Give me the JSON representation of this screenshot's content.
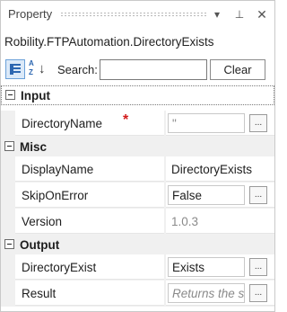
{
  "window": {
    "title": "Property",
    "controls": {
      "dropdown": "▾",
      "pin": "⊥",
      "close": "✕"
    }
  },
  "activity_name": "Robility.FTPAutomation.DirectoryExists",
  "toolbar": {
    "categorized_icon": "categorized-view-icon",
    "alphabetical_icon": "alphabetical-sort-icon",
    "alpha_top": "A",
    "alpha_bottom": "Z",
    "alpha_arrow": "↓",
    "search_label": "Search:",
    "search_value": "",
    "clear_label": "Clear"
  },
  "categories": [
    {
      "label": "Input",
      "toggle": "collapse-icon",
      "properties": [
        {
          "name": "DirectoryName",
          "required_mark": "*",
          "value": "\"",
          "ellipsis": "..."
        }
      ]
    },
    {
      "label": "Misc",
      "toggle": "collapse-icon",
      "properties": [
        {
          "name": "DisplayName",
          "value": "DirectoryExists"
        },
        {
          "name": "SkipOnError",
          "value": "False",
          "ellipsis": "..."
        },
        {
          "name": "Version",
          "value": "1.0.3"
        }
      ]
    },
    {
      "label": "Output",
      "toggle": "collapse-icon",
      "properties": [
        {
          "name": "DirectoryExist",
          "value": "Exists",
          "ellipsis": "..."
        },
        {
          "name": "Result",
          "placeholder": "Returns the su",
          "ellipsis": "..."
        }
      ]
    }
  ],
  "colors": {
    "required": "#d21b1b",
    "category_bg": "#f0f0f0",
    "selected_tool": "#dbe9f8",
    "accent": "#2c66b0"
  }
}
